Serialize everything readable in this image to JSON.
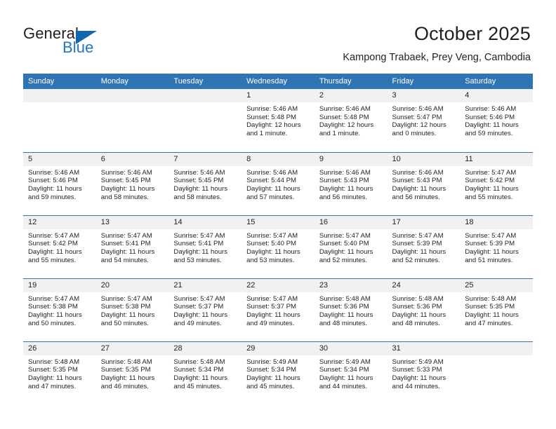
{
  "brand": {
    "name_part1": "General",
    "name_part2": "Blue",
    "accent_color": "#1f76c2",
    "triangle_color": "#1266ad"
  },
  "header": {
    "title": "October 2025",
    "subtitle": "Kampong Trabaek, Prey Veng, Cambodia"
  },
  "calendar": {
    "header_bg": "#2f75b5",
    "daynum_bg": "#f1f1f1",
    "weekday_headers": [
      "Sunday",
      "Monday",
      "Tuesday",
      "Wednesday",
      "Thursday",
      "Friday",
      "Saturday"
    ],
    "weeks": [
      [
        {
          "day": "",
          "sunrise": "",
          "sunset": "",
          "daylight": "",
          "empty": true
        },
        {
          "day": "",
          "sunrise": "",
          "sunset": "",
          "daylight": "",
          "empty": true
        },
        {
          "day": "",
          "sunrise": "",
          "sunset": "",
          "daylight": "",
          "empty": true
        },
        {
          "day": "1",
          "sunrise": "Sunrise: 5:46 AM",
          "sunset": "Sunset: 5:48 PM",
          "daylight": "Daylight: 12 hours and 1 minute.",
          "empty": false
        },
        {
          "day": "2",
          "sunrise": "Sunrise: 5:46 AM",
          "sunset": "Sunset: 5:48 PM",
          "daylight": "Daylight: 12 hours and 1 minute.",
          "empty": false
        },
        {
          "day": "3",
          "sunrise": "Sunrise: 5:46 AM",
          "sunset": "Sunset: 5:47 PM",
          "daylight": "Daylight: 12 hours and 0 minutes.",
          "empty": false
        },
        {
          "day": "4",
          "sunrise": "Sunrise: 5:46 AM",
          "sunset": "Sunset: 5:46 PM",
          "daylight": "Daylight: 11 hours and 59 minutes.",
          "empty": false
        }
      ],
      [
        {
          "day": "5",
          "sunrise": "Sunrise: 5:46 AM",
          "sunset": "Sunset: 5:46 PM",
          "daylight": "Daylight: 11 hours and 59 minutes.",
          "empty": false
        },
        {
          "day": "6",
          "sunrise": "Sunrise: 5:46 AM",
          "sunset": "Sunset: 5:45 PM",
          "daylight": "Daylight: 11 hours and 58 minutes.",
          "empty": false
        },
        {
          "day": "7",
          "sunrise": "Sunrise: 5:46 AM",
          "sunset": "Sunset: 5:45 PM",
          "daylight": "Daylight: 11 hours and 58 minutes.",
          "empty": false
        },
        {
          "day": "8",
          "sunrise": "Sunrise: 5:46 AM",
          "sunset": "Sunset: 5:44 PM",
          "daylight": "Daylight: 11 hours and 57 minutes.",
          "empty": false
        },
        {
          "day": "9",
          "sunrise": "Sunrise: 5:46 AM",
          "sunset": "Sunset: 5:43 PM",
          "daylight": "Daylight: 11 hours and 56 minutes.",
          "empty": false
        },
        {
          "day": "10",
          "sunrise": "Sunrise: 5:46 AM",
          "sunset": "Sunset: 5:43 PM",
          "daylight": "Daylight: 11 hours and 56 minutes.",
          "empty": false
        },
        {
          "day": "11",
          "sunrise": "Sunrise: 5:47 AM",
          "sunset": "Sunset: 5:42 PM",
          "daylight": "Daylight: 11 hours and 55 minutes.",
          "empty": false
        }
      ],
      [
        {
          "day": "12",
          "sunrise": "Sunrise: 5:47 AM",
          "sunset": "Sunset: 5:42 PM",
          "daylight": "Daylight: 11 hours and 55 minutes.",
          "empty": false
        },
        {
          "day": "13",
          "sunrise": "Sunrise: 5:47 AM",
          "sunset": "Sunset: 5:41 PM",
          "daylight": "Daylight: 11 hours and 54 minutes.",
          "empty": false
        },
        {
          "day": "14",
          "sunrise": "Sunrise: 5:47 AM",
          "sunset": "Sunset: 5:41 PM",
          "daylight": "Daylight: 11 hours and 53 minutes.",
          "empty": false
        },
        {
          "day": "15",
          "sunrise": "Sunrise: 5:47 AM",
          "sunset": "Sunset: 5:40 PM",
          "daylight": "Daylight: 11 hours and 53 minutes.",
          "empty": false
        },
        {
          "day": "16",
          "sunrise": "Sunrise: 5:47 AM",
          "sunset": "Sunset: 5:40 PM",
          "daylight": "Daylight: 11 hours and 52 minutes.",
          "empty": false
        },
        {
          "day": "17",
          "sunrise": "Sunrise: 5:47 AM",
          "sunset": "Sunset: 5:39 PM",
          "daylight": "Daylight: 11 hours and 52 minutes.",
          "empty": false
        },
        {
          "day": "18",
          "sunrise": "Sunrise: 5:47 AM",
          "sunset": "Sunset: 5:39 PM",
          "daylight": "Daylight: 11 hours and 51 minutes.",
          "empty": false
        }
      ],
      [
        {
          "day": "19",
          "sunrise": "Sunrise: 5:47 AM",
          "sunset": "Sunset: 5:38 PM",
          "daylight": "Daylight: 11 hours and 50 minutes.",
          "empty": false
        },
        {
          "day": "20",
          "sunrise": "Sunrise: 5:47 AM",
          "sunset": "Sunset: 5:38 PM",
          "daylight": "Daylight: 11 hours and 50 minutes.",
          "empty": false
        },
        {
          "day": "21",
          "sunrise": "Sunrise: 5:47 AM",
          "sunset": "Sunset: 5:37 PM",
          "daylight": "Daylight: 11 hours and 49 minutes.",
          "empty": false
        },
        {
          "day": "22",
          "sunrise": "Sunrise: 5:47 AM",
          "sunset": "Sunset: 5:37 PM",
          "daylight": "Daylight: 11 hours and 49 minutes.",
          "empty": false
        },
        {
          "day": "23",
          "sunrise": "Sunrise: 5:48 AM",
          "sunset": "Sunset: 5:36 PM",
          "daylight": "Daylight: 11 hours and 48 minutes.",
          "empty": false
        },
        {
          "day": "24",
          "sunrise": "Sunrise: 5:48 AM",
          "sunset": "Sunset: 5:36 PM",
          "daylight": "Daylight: 11 hours and 48 minutes.",
          "empty": false
        },
        {
          "day": "25",
          "sunrise": "Sunrise: 5:48 AM",
          "sunset": "Sunset: 5:35 PM",
          "daylight": "Daylight: 11 hours and 47 minutes.",
          "empty": false
        }
      ],
      [
        {
          "day": "26",
          "sunrise": "Sunrise: 5:48 AM",
          "sunset": "Sunset: 5:35 PM",
          "daylight": "Daylight: 11 hours and 47 minutes.",
          "empty": false
        },
        {
          "day": "27",
          "sunrise": "Sunrise: 5:48 AM",
          "sunset": "Sunset: 5:35 PM",
          "daylight": "Daylight: 11 hours and 46 minutes.",
          "empty": false
        },
        {
          "day": "28",
          "sunrise": "Sunrise: 5:48 AM",
          "sunset": "Sunset: 5:34 PM",
          "daylight": "Daylight: 11 hours and 45 minutes.",
          "empty": false
        },
        {
          "day": "29",
          "sunrise": "Sunrise: 5:49 AM",
          "sunset": "Sunset: 5:34 PM",
          "daylight": "Daylight: 11 hours and 45 minutes.",
          "empty": false
        },
        {
          "day": "30",
          "sunrise": "Sunrise: 5:49 AM",
          "sunset": "Sunset: 5:34 PM",
          "daylight": "Daylight: 11 hours and 44 minutes.",
          "empty": false
        },
        {
          "day": "31",
          "sunrise": "Sunrise: 5:49 AM",
          "sunset": "Sunset: 5:33 PM",
          "daylight": "Daylight: 11 hours and 44 minutes.",
          "empty": false
        },
        {
          "day": "",
          "sunrise": "",
          "sunset": "",
          "daylight": "",
          "empty": true
        }
      ]
    ]
  }
}
